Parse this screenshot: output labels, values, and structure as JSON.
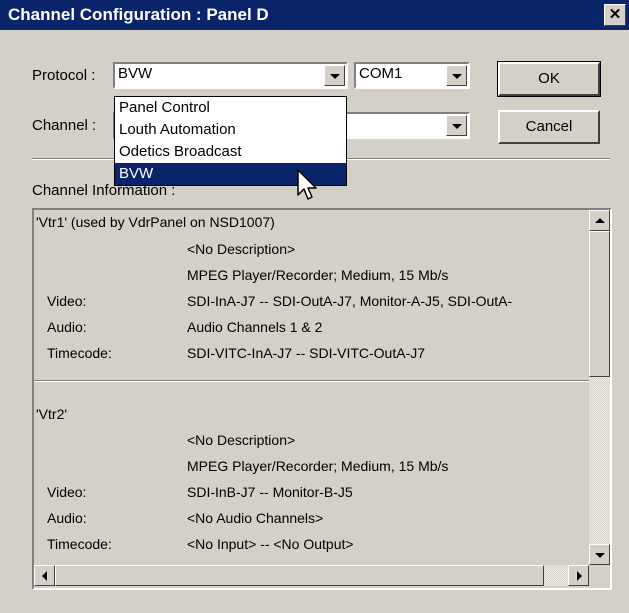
{
  "window": {
    "title": "Channel Configuration : Panel D",
    "close_glyph": "✕"
  },
  "protocol": {
    "label": "Protocol :",
    "value": "BVW",
    "options": [
      "Panel Control",
      "Louth Automation",
      "Odetics Broadcast",
      "BVW"
    ],
    "selected_index": 3
  },
  "port": {
    "value": "COM1"
  },
  "channel": {
    "label": "Channel :",
    "value": ""
  },
  "buttons": {
    "ok": "OK",
    "cancel": "Cancel"
  },
  "info": {
    "label": "Channel Information :",
    "channels": [
      {
        "header": "'Vtr1' (used by VdrPanel on NSD1007)",
        "description": "<No Description>",
        "type": "MPEG Player/Recorder; Medium, 15 Mb/s",
        "video_label": "Video:",
        "video": "SDI-InA-J7 -- SDI-OutA-J7, Monitor-A-J5, SDI-OutA-",
        "audio_label": "Audio:",
        "audio": "Audio Channels 1 & 2",
        "timecode_label": "Timecode:",
        "timecode": "SDI-VITC-InA-J7 -- SDI-VITC-OutA-J7"
      },
      {
        "header": "'Vtr2'",
        "description": "<No Description>",
        "type": "MPEG Player/Recorder; Medium, 15 Mb/s",
        "video_label": "Video:",
        "video": "SDI-InB-J7 -- Monitor-B-J5",
        "audio_label": "Audio:",
        "audio": "<No Audio Channels>",
        "timecode_label": "Timecode:",
        "timecode": "<No Input> -- <No Output>"
      }
    ]
  },
  "colors": {
    "face": "#d4d0c8",
    "title_bar": "#0a246a",
    "highlight": "#0a246a"
  }
}
